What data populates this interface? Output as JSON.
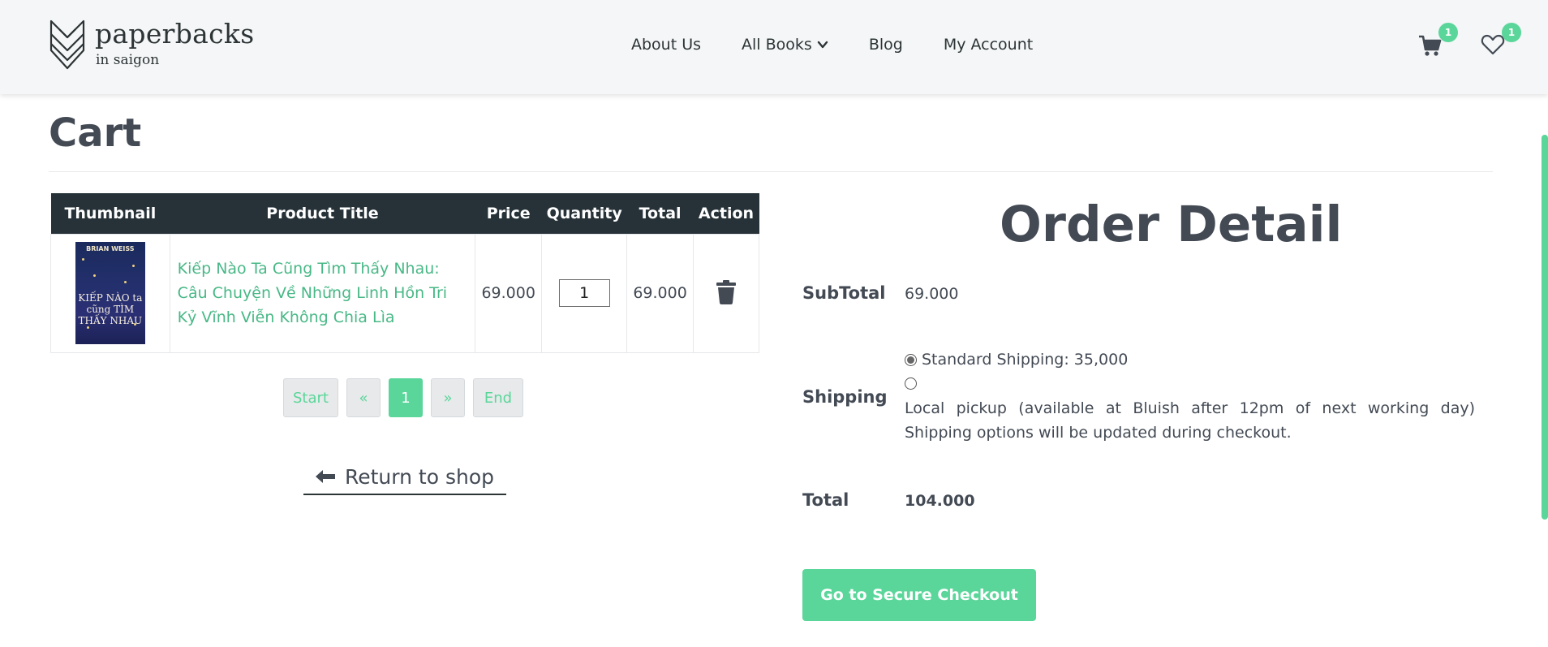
{
  "brand": {
    "name": "paperbacks",
    "tagline": "in saigon"
  },
  "nav": {
    "items": [
      {
        "label": "About Us"
      },
      {
        "label": "All Books"
      },
      {
        "label": "Blog"
      },
      {
        "label": "My Account"
      }
    ]
  },
  "header_icons": {
    "cart_count": "1",
    "wishlist_count": "1"
  },
  "page": {
    "title": "Cart"
  },
  "cart_table": {
    "headers": [
      "Thumbnail",
      "Product Title",
      "Price",
      "Quantity",
      "Total",
      "Action"
    ],
    "rows": [
      {
        "title": "Kiếp Nào Ta Cũng Tìm Thấy Nhau: Câu Chuyện Về Những Linh Hồn Tri Kỷ Vĩnh Viễn Không Chia Lìa",
        "price": "69.000",
        "quantity": "1",
        "total": "69.000",
        "cover_author": "BRIAN WEISS",
        "cover_title": "KIẾP NÀO ta cũng TÌM THẤY NHAU"
      }
    ]
  },
  "pagination": {
    "start": "Start",
    "prev": "«",
    "current": "1",
    "next": "»",
    "end": "End"
  },
  "return_link": "Return to shop",
  "order": {
    "title": "Order Detail",
    "subtotal_label": "SubTotal",
    "subtotal": "69.000",
    "shipping_label": "Shipping",
    "shipping_option_1": "Standard Shipping: 35,000",
    "shipping_note": "Local pickup (available at Bluish after 12pm of next working day) Shipping options will be updated during checkout.",
    "total_label": "Total",
    "total": "104.000",
    "checkout_label": "Go to Secure Checkout"
  },
  "colors": {
    "accent": "#5ad69a",
    "link": "#48b886",
    "table_header": "#263238",
    "text": "#434a54"
  }
}
